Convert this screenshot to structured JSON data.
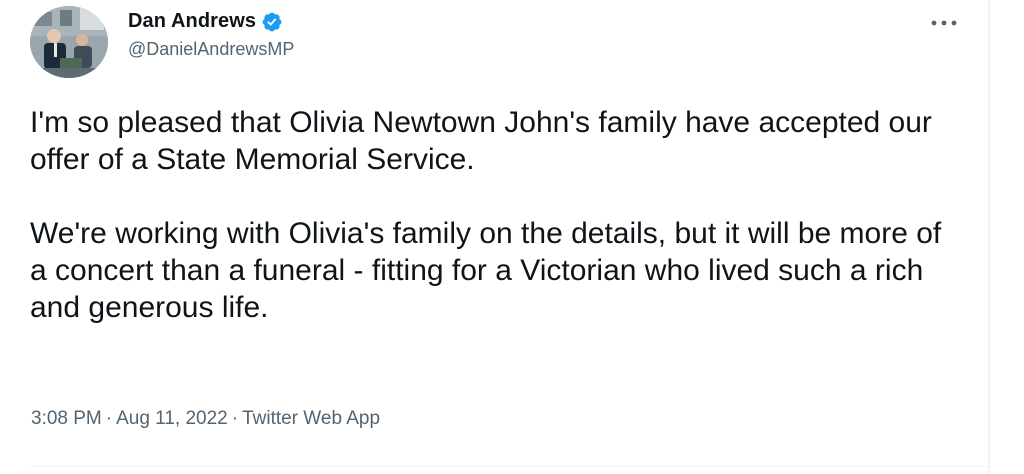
{
  "author": {
    "display_name": "Dan Andrews",
    "handle": "@DanielAndrewsMP",
    "verified": true,
    "verified_icon": "verified-badge-icon",
    "avatar_icon": "profile-photo"
  },
  "more_icon": "more-options-icon",
  "more_label": "•••",
  "tweet": {
    "paragraph_1": "I'm so pleased that Olivia Newtown John's family have accepted our offer of a State Memorial Service.",
    "paragraph_2": "We're working with Olivia's family on the details, but it will be more of a concert than a funeral - fitting for a Victorian who lived such a rich and generous life."
  },
  "meta": {
    "time": "3:08 PM",
    "separator": "·",
    "date": "Aug 11, 2022",
    "source": "Twitter Web App"
  },
  "colors": {
    "text_primary": "#0f1419",
    "text_secondary": "#536471",
    "verified_blue": "#1d9bf0",
    "divider": "#eff3f4"
  }
}
